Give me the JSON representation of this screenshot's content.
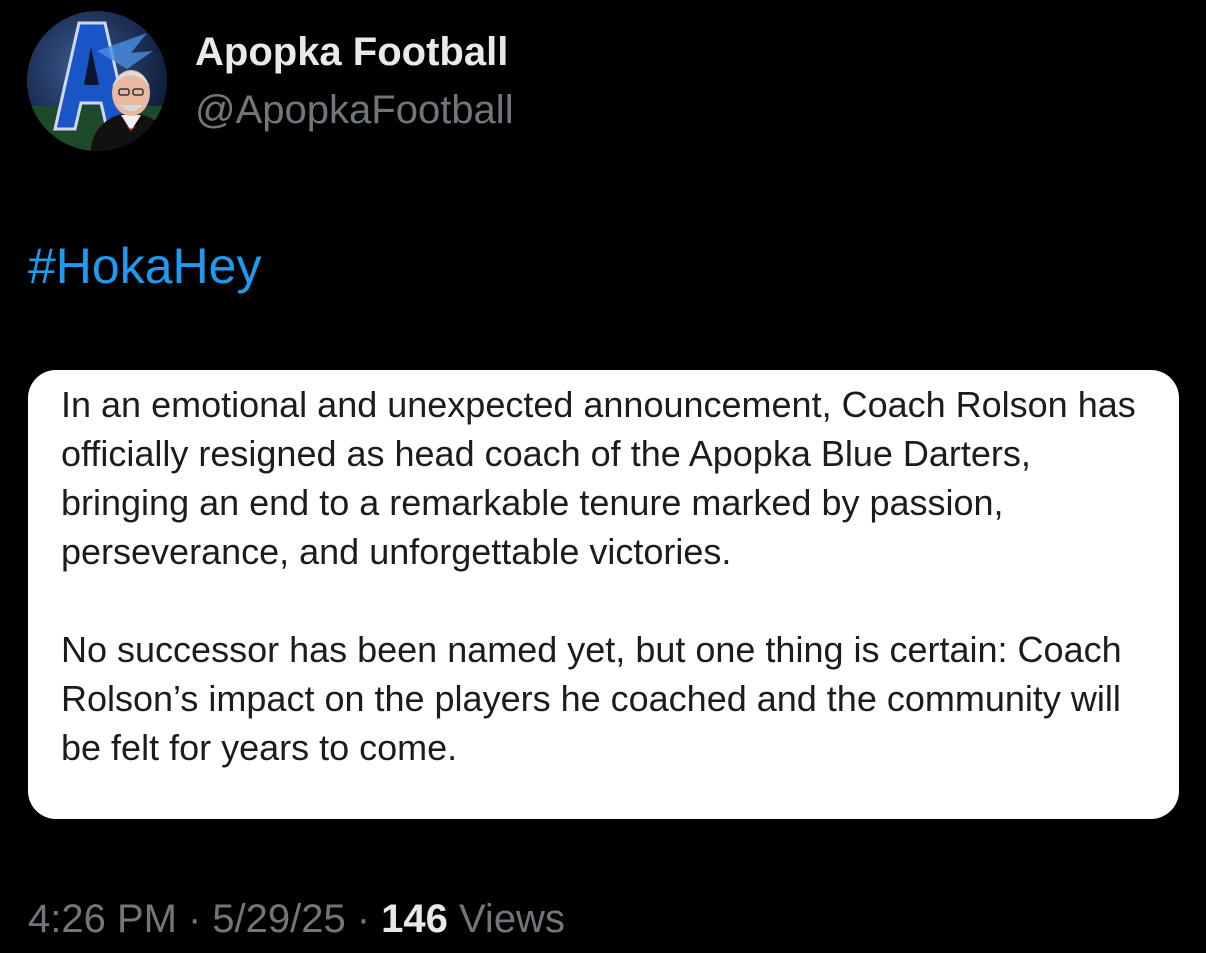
{
  "account": {
    "display_name": "Apopka Football",
    "handle": "@ApopkaFootball"
  },
  "tweet": {
    "hashtag": "#HokaHey",
    "card_paragraphs": [
      "In an emotional and unexpected announcement, Coach Rolson has officially resigned as head coach of the Apopka Blue Darters, bringing an end to a remarkable tenure marked by passion, perseverance, and unforgettable victories.",
      "No successor has been named yet, but one thing is certain: Coach Rolson’s impact on the players he coached and the community will be felt for years to come."
    ]
  },
  "meta": {
    "time": "4:26 PM",
    "separator": "·",
    "date": "5/29/25",
    "views_count": "146",
    "views_label": "Views"
  },
  "colors": {
    "background": "#000000",
    "primary_text": "#e7e9ea",
    "secondary_text": "#71767b",
    "hashtag": "#1d9bf0",
    "card_background": "#ffffff",
    "card_text": "#1c1c1e"
  },
  "icons": {
    "avatar": "profile-photo-avatar"
  }
}
